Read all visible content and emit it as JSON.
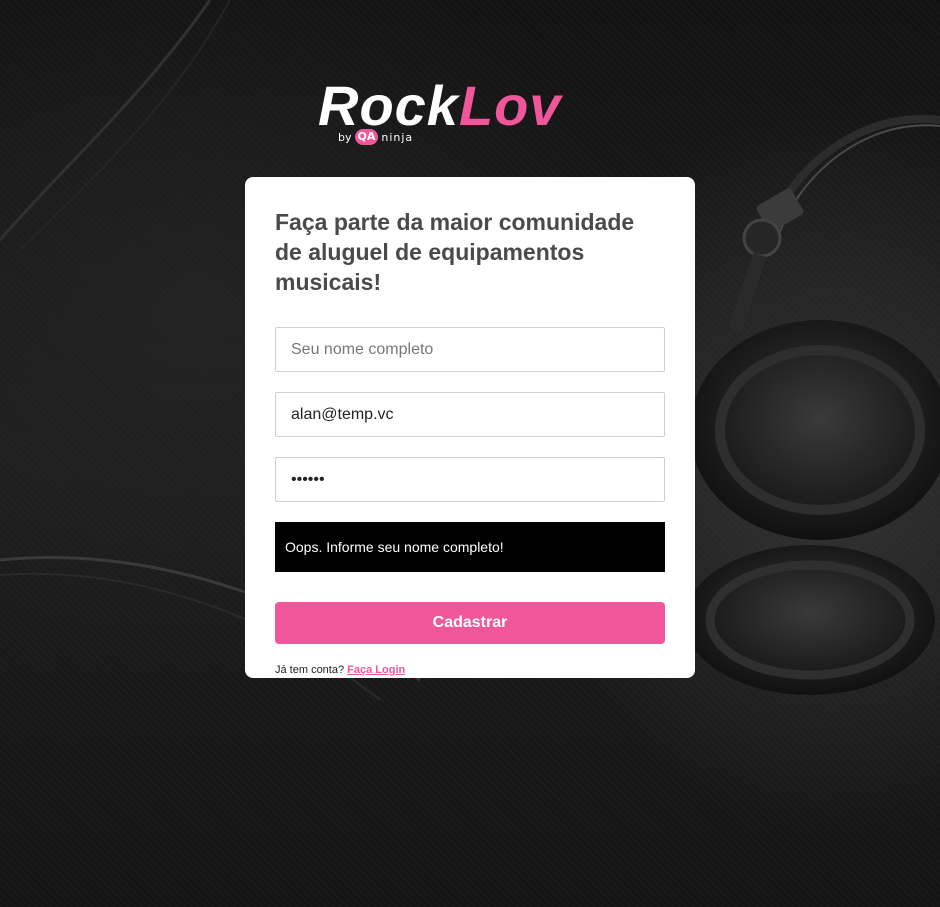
{
  "brand": {
    "name_part1": "Rock",
    "name_part2": "Lov",
    "by": "by",
    "qa": "QA",
    "ninja": "ninja",
    "accent_color": "#f0579b"
  },
  "signup": {
    "heading": "Faça parte da maior comunidade de aluguel de equipamentos musicais!",
    "name_placeholder": "Seu nome completo",
    "name_value": "",
    "email_value": "alan@temp.vc",
    "password_value": "123456",
    "error_message": "Oops. Informe seu nome completo!",
    "submit_label": "Cadastrar",
    "login_prompt": "Já tem conta?",
    "login_link": "Faça Login"
  },
  "icons": {
    "background": "headphones-photo"
  }
}
